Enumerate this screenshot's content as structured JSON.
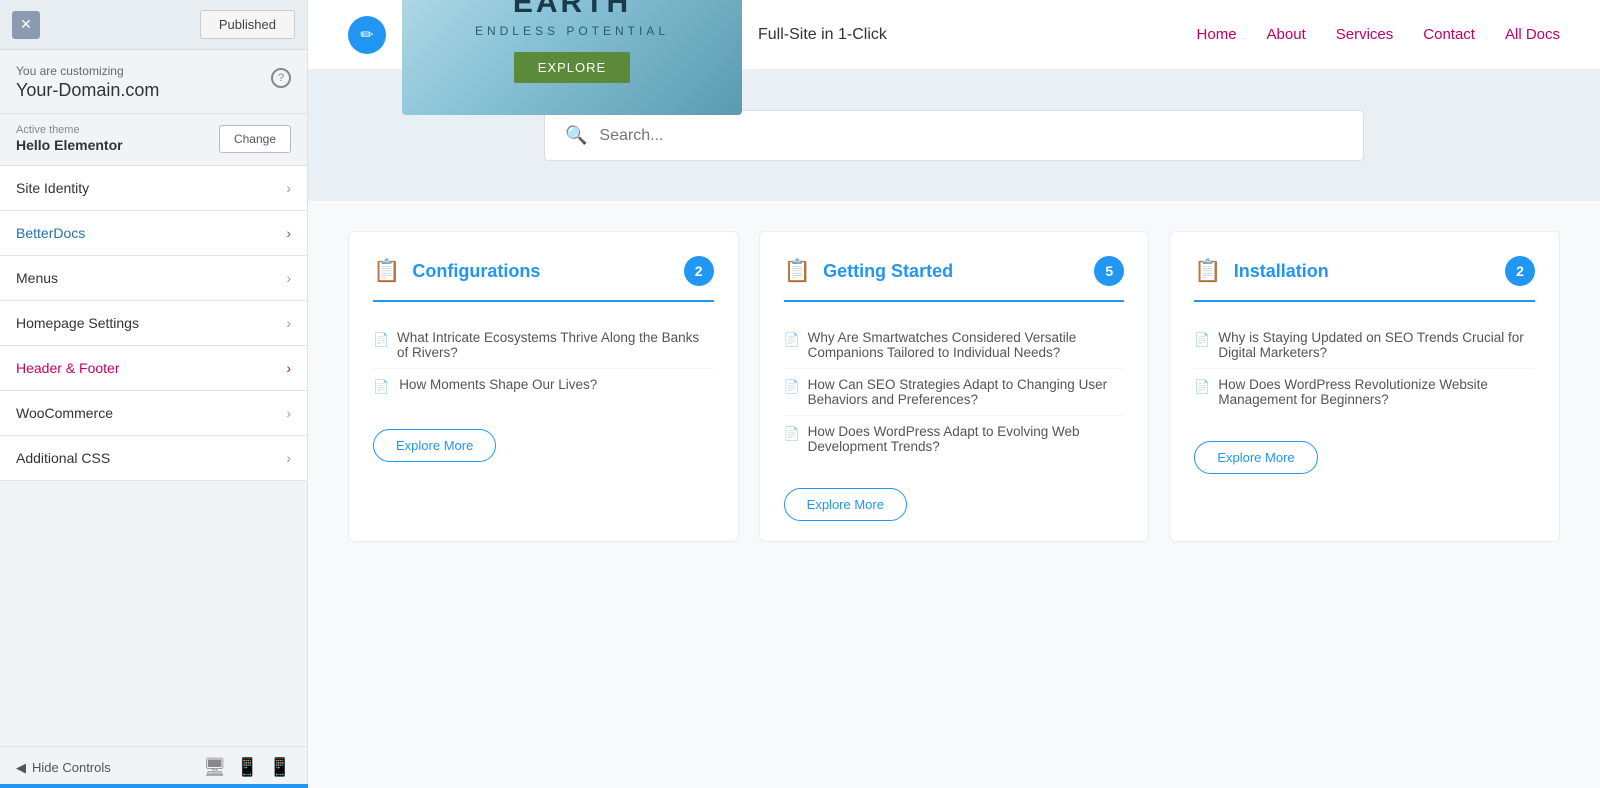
{
  "panel": {
    "close_label": "✕",
    "published_label": "Published",
    "customizing_label": "You are customizing",
    "domain": "Your-Domain.com",
    "help_label": "?",
    "theme_label": "Active theme",
    "theme_name": "Hello Elementor",
    "change_label": "Change",
    "nav_items": [
      {
        "id": "site-identity",
        "label": "Site Identity",
        "active": false,
        "color": "default"
      },
      {
        "id": "betterdocs",
        "label": "BetterDocs",
        "active": true,
        "color": "blue"
      },
      {
        "id": "menus",
        "label": "Menus",
        "active": false,
        "color": "default"
      },
      {
        "id": "homepage-settings",
        "label": "Homepage Settings",
        "active": false,
        "color": "default"
      },
      {
        "id": "header-footer",
        "label": "Header & Footer",
        "active": false,
        "color": "pink"
      },
      {
        "id": "woocommerce",
        "label": "WooCommerce",
        "active": false,
        "color": "default"
      },
      {
        "id": "additional-css",
        "label": "Additional CSS",
        "active": false,
        "color": "default"
      }
    ],
    "hide_controls_label": "Hide Controls",
    "footer_icons": [
      "desktop",
      "tablet",
      "mobile"
    ]
  },
  "header": {
    "banner_title": "EARTH",
    "banner_subtitle": "ENDLESS POTENTIAL",
    "banner_explore": "EXPLORE",
    "full_site_text": "Full-Site in 1-Click",
    "nav_items": [
      "Home",
      "About",
      "Services",
      "Contact",
      "All Docs"
    ]
  },
  "search": {
    "placeholder": "Search...",
    "icon": "🔍"
  },
  "cards": [
    {
      "id": "configurations",
      "title": "Configurations",
      "count": "2",
      "docs": [
        "What Intricate Ecosystems Thrive Along the Banks of Rivers?",
        "How Moments Shape Our Lives?"
      ],
      "explore_label": "Explore More"
    },
    {
      "id": "getting-started",
      "title": "Getting Started",
      "count": "5",
      "docs": [
        "Why Are Smartwatches Considered Versatile Companions Tailored to Individual Needs?",
        "How Can SEO Strategies Adapt to Changing User Behaviors and Preferences?",
        "How Does WordPress Adapt to Evolving Web Development Trends?"
      ],
      "explore_label": "Explore More"
    },
    {
      "id": "installation",
      "title": "Installation",
      "count": "2",
      "docs": [
        "Why is Staying Updated on SEO Trends Crucial for Digital Marketers?",
        "How Does WordPress Revolutionize Website Management for Beginners?"
      ],
      "explore_label": "Explore More"
    }
  ],
  "colors": {
    "blue": "#2196F3",
    "pink": "#c0006a"
  }
}
